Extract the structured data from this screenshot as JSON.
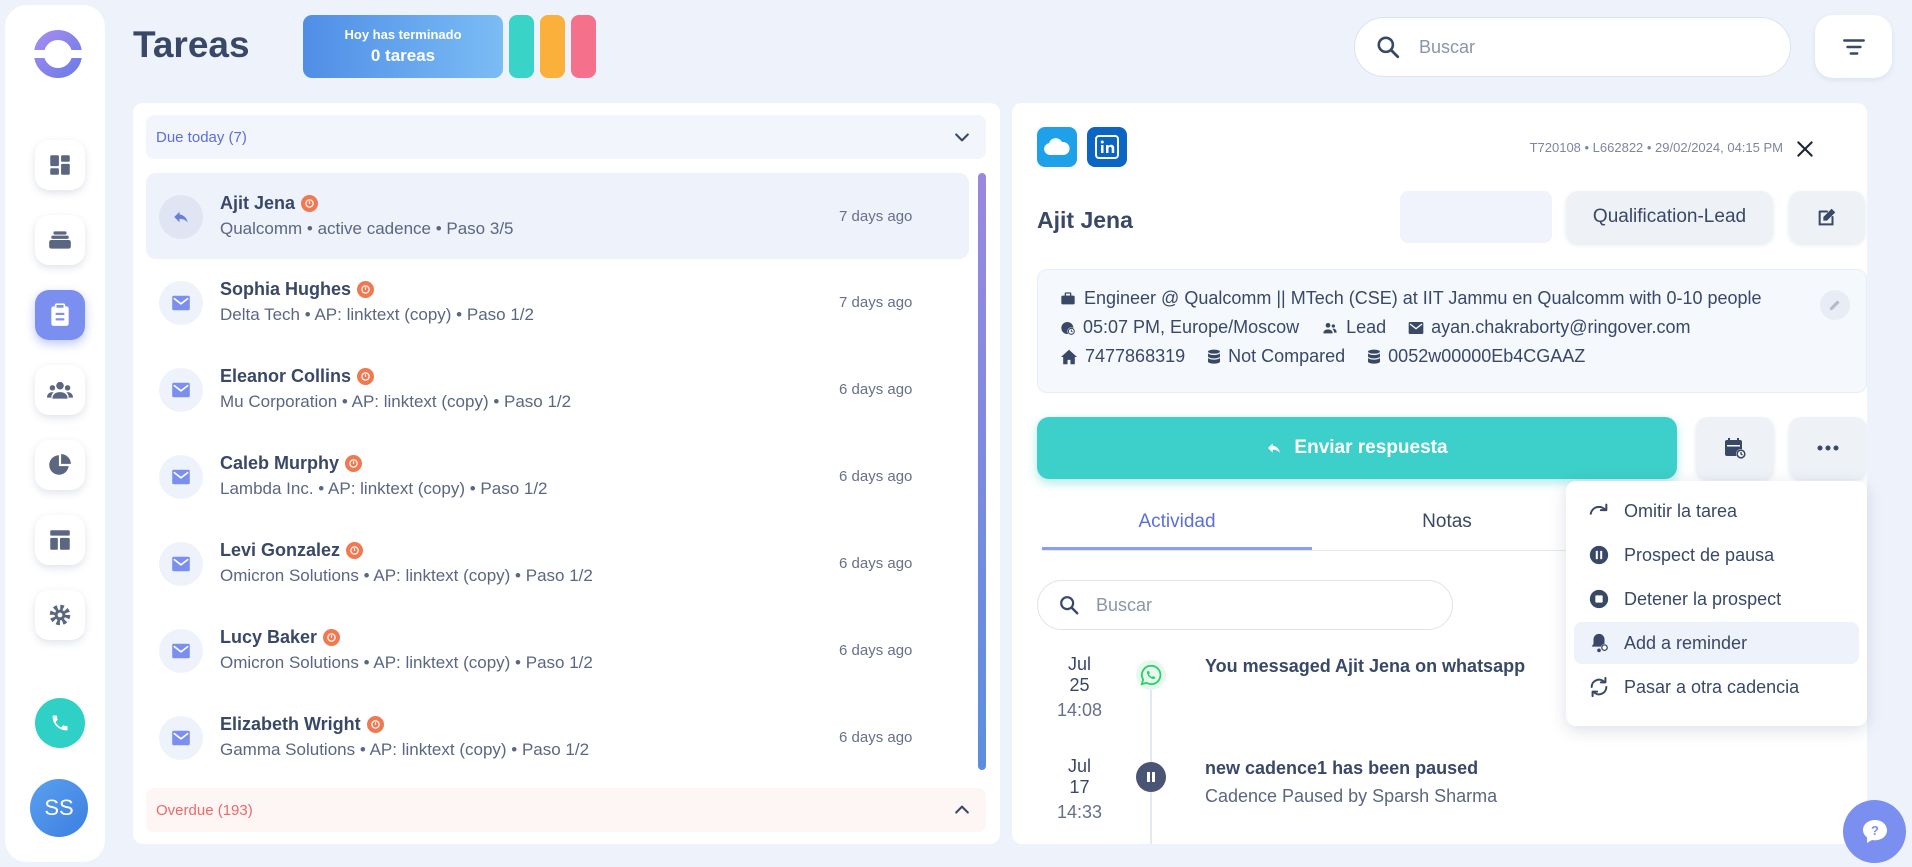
{
  "user": {
    "initials": "SS"
  },
  "header": {
    "title": "Tareas",
    "done_label": "Hoy has terminado",
    "done_count": "0 tareas",
    "search_placeholder": "Buscar"
  },
  "sections": {
    "due": "Due today (7)",
    "overdue": "Overdue (193)"
  },
  "tasks": [
    {
      "name": "Ajit Jena",
      "sub": "Qualcomm • active cadence • Paso 3/5",
      "time": "7 days ago",
      "icon": "reply-icon"
    },
    {
      "name": "Sophia Hughes",
      "sub": "Delta Tech • AP: linktext (copy) • Paso 1/2",
      "time": "7 days ago",
      "icon": "mail-icon"
    },
    {
      "name": "Eleanor Collins",
      "sub": "Mu Corporation • AP: linktext (copy) • Paso 1/2",
      "time": "6 days ago",
      "icon": "mail-icon"
    },
    {
      "name": "Caleb Murphy",
      "sub": "Lambda Inc. • AP: linktext (copy) • Paso 1/2",
      "time": "6 days ago",
      "icon": "mail-icon"
    },
    {
      "name": "Levi Gonzalez",
      "sub": "Omicron Solutions • AP: linktext (copy) • Paso 1/2",
      "time": "6 days ago",
      "icon": "mail-icon"
    },
    {
      "name": "Lucy Baker",
      "sub": "Omicron Solutions • AP: linktext (copy) • Paso 1/2",
      "time": "6 days ago",
      "icon": "mail-icon"
    },
    {
      "name": "Elizabeth Wright",
      "sub": "Gamma Solutions • AP: linktext (copy) • Paso 1/2",
      "time": "6 days ago",
      "icon": "mail-icon"
    }
  ],
  "detail": {
    "meta": "T720108 • L662822 • 29/02/2024, 04:15 PM",
    "name": "Ajit Jena",
    "status_button": "Qualification-Lead",
    "headline": "Engineer @ Qualcomm || MTech (CSE) at IIT Jammu en Qualcomm with 0-10 people",
    "local_time": "05:07 PM, Europe/Moscow",
    "type": "Lead",
    "email": "ayan.chakraborty@ringover.com",
    "phone": "7477868319",
    "compare": "Not Compared",
    "crm_id": "0052w00000Eb4CGAAZ",
    "send_button": "Enviar respuesta",
    "tabs": [
      "Actividad",
      "Notas"
    ],
    "search_placeholder": "Buscar",
    "activities": [
      {
        "date": "Jul 25",
        "time": "14:08",
        "title": "You messaged Ajit Jena on whatsapp",
        "sub": ""
      },
      {
        "date": "Jul 17",
        "time": "14:33",
        "title": "new cadence1 has been paused",
        "sub": "Cadence Paused by Sparsh Sharma"
      }
    ]
  },
  "menu": [
    {
      "label": "Omitir la tarea",
      "icon": "skip-icon"
    },
    {
      "label": "Prospect de pausa",
      "icon": "pause-icon"
    },
    {
      "label": "Detener la prospect",
      "icon": "stop-icon"
    },
    {
      "label": "Add a reminder",
      "icon": "bell-icon"
    },
    {
      "label": "Pasar a otra cadencia",
      "icon": "refresh-icon"
    }
  ],
  "colors": {
    "accent": "#7b8ff0",
    "teal": "#3dcfc9",
    "pill1": "#3ad3c8",
    "pill2": "#fbb03b",
    "pill3": "#f5708a"
  }
}
